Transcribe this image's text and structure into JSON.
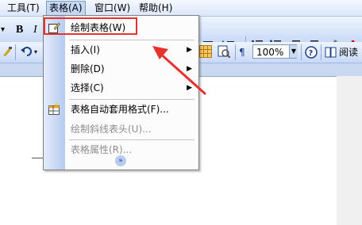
{
  "menubar": {
    "items": [
      {
        "label": "工具(T)"
      },
      {
        "label": "表格(A)"
      },
      {
        "label": "窗口(W)"
      },
      {
        "label": "帮助(H)"
      }
    ]
  },
  "toolbar": {
    "bold": "B",
    "italic": "I",
    "zoom": "100%",
    "read_label": "阅读",
    "icons": [
      "undo-icon",
      "brush-icon",
      "table-icon",
      "line-spacing-icon",
      "numbering-icon",
      "bullets-icon",
      "indent-icon",
      "highlight-icon",
      "help-icon",
      "read-icon"
    ]
  },
  "menu": {
    "items": [
      {
        "label": "绘制表格(W)",
        "enabled": true,
        "icon": "pencil-table-icon"
      },
      {
        "label": "插入(I)",
        "enabled": true,
        "submenu": true
      },
      {
        "label": "删除(D)",
        "enabled": true,
        "submenu": true
      },
      {
        "label": "选择(C)",
        "enabled": true,
        "submenu": true
      },
      {
        "label": "表格自动套用格式(F)...",
        "enabled": true,
        "icon": "table-autoformat-icon"
      },
      {
        "label": "绘制斜线表头(U)...",
        "enabled": false
      },
      {
        "label": "表格属性(R)...",
        "enabled": false
      }
    ],
    "expand_glyph": "»"
  },
  "annotation": {
    "highlight_color": "#e8322d"
  }
}
